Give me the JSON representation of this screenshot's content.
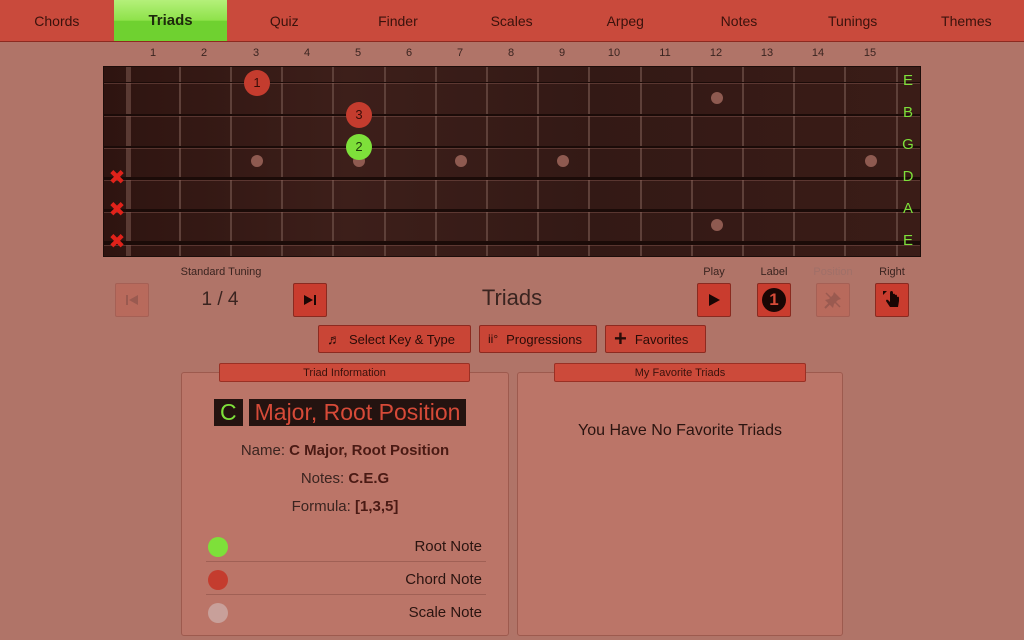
{
  "nav": {
    "tabs": [
      {
        "label": "Chords"
      },
      {
        "label": "Triads"
      },
      {
        "label": "Quiz"
      },
      {
        "label": "Finder"
      },
      {
        "label": "Scales"
      },
      {
        "label": "Arpeg"
      },
      {
        "label": "Notes"
      },
      {
        "label": "Tunings"
      },
      {
        "label": "Themes"
      }
    ],
    "active": "Triads"
  },
  "fretboard": {
    "fret_numbers": [
      "1",
      "2",
      "3",
      "4",
      "5",
      "6",
      "7",
      "8",
      "9",
      "10",
      "11",
      "12",
      "13",
      "14",
      "15"
    ],
    "strings": [
      "E",
      "B",
      "G",
      "D",
      "A",
      "E"
    ],
    "muted_strings": [
      "D",
      "A",
      "E"
    ],
    "mute_symbol": "✖",
    "notes": [
      {
        "string": "E",
        "fret": 3,
        "label": "1",
        "kind": "chord"
      },
      {
        "string": "B",
        "fret": 5,
        "label": "3",
        "kind": "chord"
      },
      {
        "string": "G",
        "fret": 5,
        "label": "2",
        "kind": "root"
      }
    ]
  },
  "controls": {
    "tuning": "Standard Tuning",
    "counter": "1 / 4",
    "heading": "Triads",
    "play_label": "Play",
    "label_label": "Label",
    "position_label": "Position",
    "right_label": "Right",
    "label_badge": "1"
  },
  "actions": {
    "select_key": "Select Key & Type",
    "progressions": "Progressions",
    "progressions_icon": "ii°",
    "favorites": "Favorites"
  },
  "triad_info": {
    "header": "Triad Information",
    "key": "C",
    "type": "Major, Root Position",
    "name_label": "Name:",
    "name_value": "C Major, Root Position",
    "notes_label": "Notes:",
    "notes_value": "C.E.G",
    "formula_label": "Formula:",
    "formula_value": "[1,3,5]",
    "legend": [
      {
        "label": "Root Note",
        "color": "#7ee03a"
      },
      {
        "label": "Chord Note",
        "color": "#c43c2e"
      },
      {
        "label": "Scale Note",
        "color": "#c8a09a"
      }
    ]
  },
  "favorites_panel": {
    "header": "My Favorite Triads",
    "empty_text": "You Have No Favorite Triads"
  }
}
